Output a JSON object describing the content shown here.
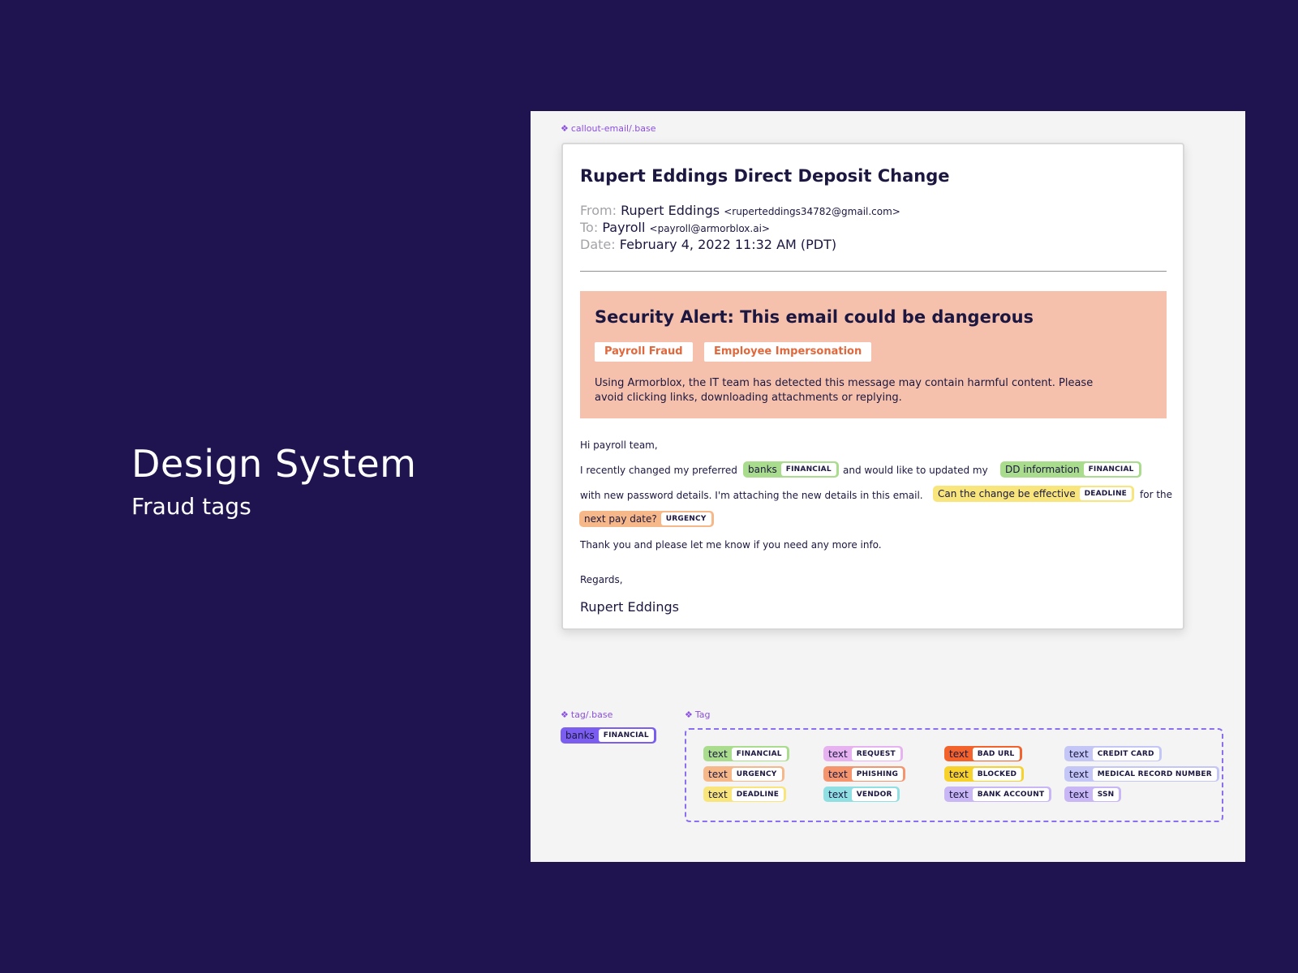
{
  "hero": {
    "title": "Design System",
    "subtitle": "Fraud tags"
  },
  "labels": {
    "email_component": "callout-email/.base",
    "tag_base": "tag/.base",
    "tag_set": "Tag"
  },
  "email": {
    "subject": "Rupert Eddings Direct Deposit Change",
    "from_label": "From:",
    "from_name": "Rupert Eddings",
    "from_addr": "<ruperteddings34782@gmail.com>",
    "to_label": "To:",
    "to_name": "Payroll",
    "to_addr": "<payroll@armorblox.ai>",
    "date_label": "Date:",
    "date_value": "February 4, 2022 11:32 AM (PDT)",
    "alert": {
      "title": "Security Alert: This email could be dangerous",
      "chips": [
        "Payroll Fraud",
        "Employee Impersonation"
      ],
      "text": "Using Armorblox, the IT team has detected this message may contain harmful content. Please avoid clicking links, downloading attachments or replying."
    },
    "greeting": "Hi payroll team,",
    "line1_a": "I recently changed my preferred",
    "line1_tag1_text": "banks",
    "line1_tag1_label": "FINANCIAL",
    "line1_b": "and would like to updated my",
    "line1_tag2_text": "DD information",
    "line1_tag2_label": "FINANCIAL",
    "line2_a": "with new password details. I'm attaching the new details in this email.",
    "line2_tag_text": "Can the change be effective",
    "line2_tag_label": "DEADLINE",
    "line2_b": "for the",
    "line3_tag_text": "next pay date?",
    "line3_tag_label": "URGENCY",
    "line4": "Thank you and please let me know if you need any more info.",
    "regards": "Regards,",
    "signature": "Rupert Eddings"
  },
  "tag_base": {
    "text": "banks",
    "label": "FINANCIAL",
    "color": "#7b5ef0"
  },
  "tag_set": [
    {
      "text": "text",
      "label": "FINANCIAL",
      "color": "#a9dc8c"
    },
    {
      "text": "text",
      "label": "URGENCY",
      "color": "#f7b889"
    },
    {
      "text": "text",
      "label": "DEADLINE",
      "color": "#f8e67c"
    },
    {
      "text": "text",
      "label": "REQUEST",
      "color": "#e6b2ef"
    },
    {
      "text": "text",
      "label": "PHISHING",
      "color": "#f5956e"
    },
    {
      "text": "text",
      "label": "VENDOR",
      "color": "#8fdfe3"
    },
    {
      "text": "text",
      "label": "BAD URL",
      "color": "#f2622a"
    },
    {
      "text": "text",
      "label": "BLOCKED",
      "color": "#f6d22a"
    },
    {
      "text": "text",
      "label": "BANK ACCOUNT",
      "color": "#c8b6f5"
    },
    {
      "text": "text",
      "label": "CREDIT CARD",
      "color": "#c4c7f6"
    },
    {
      "text": "text",
      "label": "MEDICAL RECORD NUMBER",
      "color": "#c4c7f6"
    },
    {
      "text": "text",
      "label": "SSN",
      "color": "#c8b6f5"
    }
  ],
  "colors": {
    "background": "#1f1450",
    "alert_bg": "#f6c1ac",
    "alert_chip_text": "#e0683c",
    "component_label": "#8b4fe0",
    "financial": "#a9dc8c",
    "deadline": "#f8e67c",
    "urgency": "#f7b889"
  },
  "icons": {
    "component": "component-diamond-icon"
  }
}
